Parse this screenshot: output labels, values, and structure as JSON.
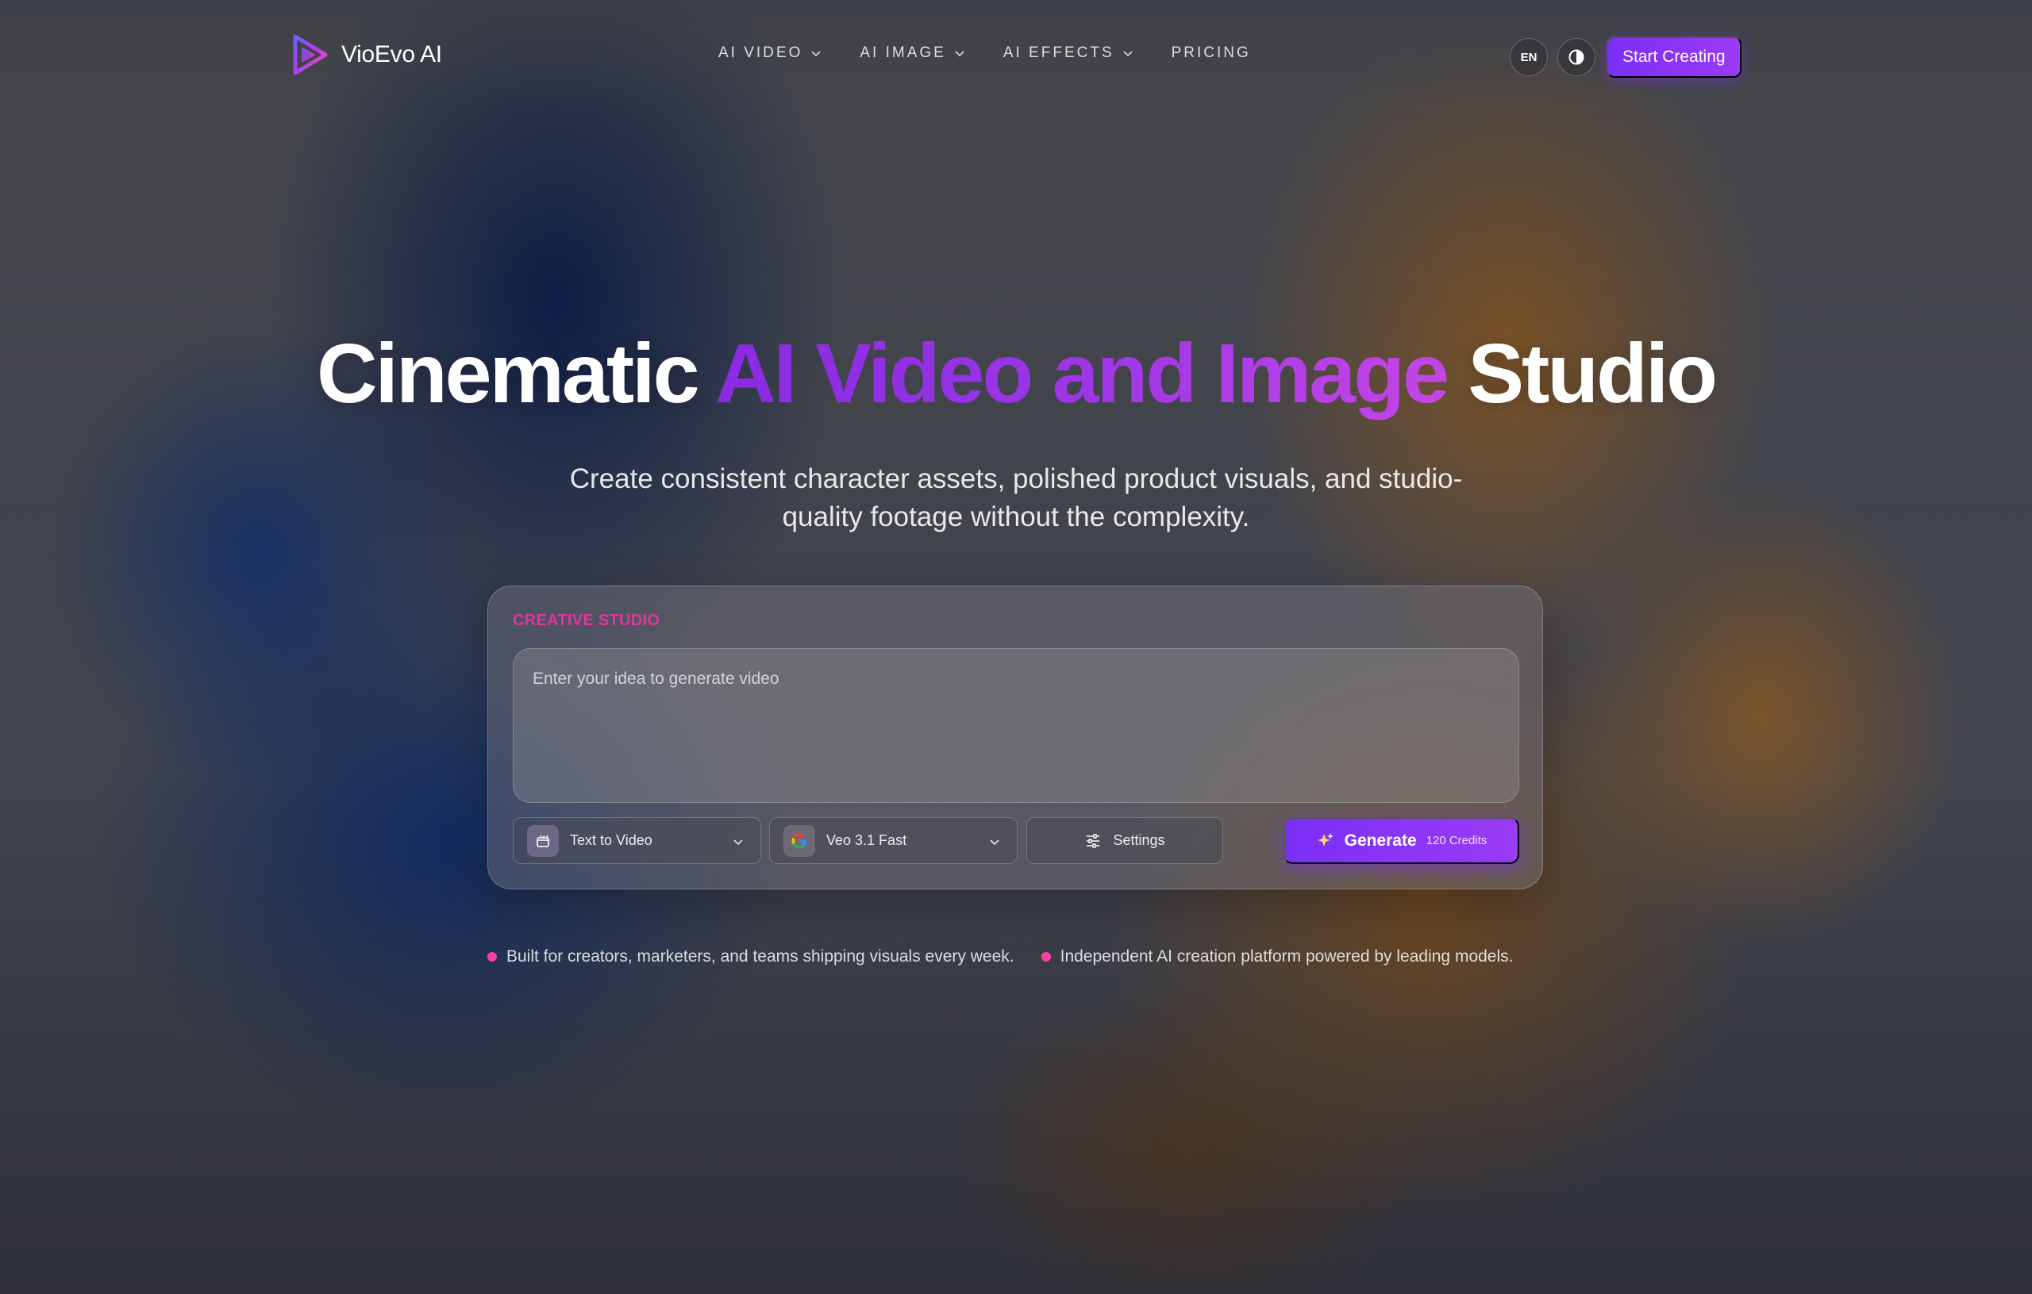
{
  "brand": {
    "name": "VioEvo AI",
    "logo_icon": "play-triangle-icon"
  },
  "nav": {
    "items": [
      {
        "label": "AI VIDEO",
        "has_dropdown": true
      },
      {
        "label": "AI IMAGE",
        "has_dropdown": true
      },
      {
        "label": "AI EFFECTS",
        "has_dropdown": true
      },
      {
        "label": "PRICING",
        "has_dropdown": false
      }
    ],
    "language": "EN",
    "theme_icon": "contrast-icon",
    "cta_label": "Start Creating"
  },
  "hero": {
    "title_start": "Cinematic ",
    "title_highlight": "AI Video and Image",
    "title_end": " Studio",
    "subtitle": "Create consistent character assets, polished product visuals, and studio-quality footage without the complexity."
  },
  "studio": {
    "label": "CREATIVE STUDIO",
    "prompt_placeholder": "Enter your idea to generate video",
    "prompt_value": "",
    "mode": "Text to Video",
    "model": "Veo 3.1 Fast",
    "settings_label": "Settings",
    "generate_label": "Generate",
    "credits": "120 Credits"
  },
  "notes": [
    "Built for creators, marketers, and teams shipping visuals every week.",
    "Independent AI creation platform powered by leading models."
  ],
  "colors": {
    "accent": "#7b2ff7",
    "label_pink": "#e0369c",
    "dot_pink": "#ff3fa6"
  }
}
